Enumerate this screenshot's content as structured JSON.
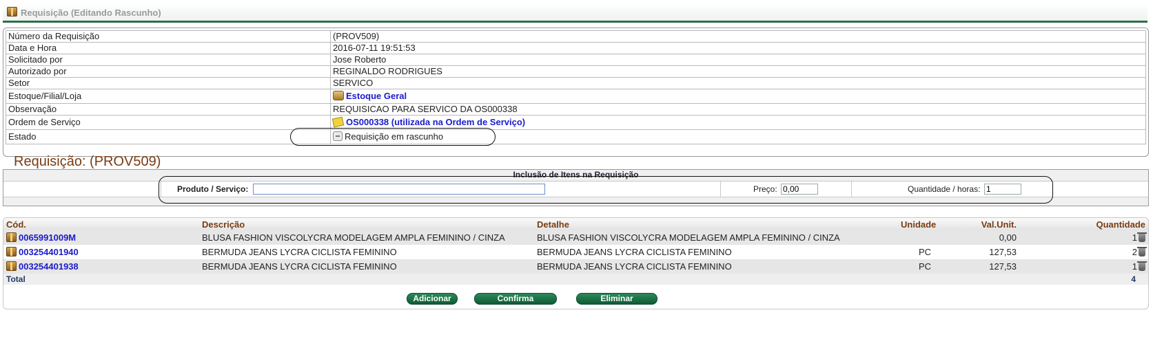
{
  "window": {
    "title": "Requisição (Editando Rascunho)"
  },
  "info": {
    "rows": [
      {
        "label": "Número da Requisição",
        "value": "(PROV509)"
      },
      {
        "label": "Data e Hora",
        "value": "2016-07-11 19:51:53"
      },
      {
        "label": "Solicitado por",
        "value": "Jose Roberto"
      },
      {
        "label": "Autorizado por",
        "value": "REGINALDO RODRIGUES"
      },
      {
        "label": "Setor",
        "value": "SERVICO"
      },
      {
        "label": "Estoque/Filial/Loja",
        "value": "Estoque Geral",
        "icon": "stock-box-icon"
      },
      {
        "label": "Observação",
        "value": "REQUISICAO PARA SERVICO DA OS000338"
      },
      {
        "label": "Ordem de Serviço",
        "value": "OS000338 (utilizada na Ordem de Serviço)",
        "icon": "note-icon"
      },
      {
        "label": "Estado",
        "value": "Requisição em rascunho",
        "icon": "draft-icon"
      }
    ]
  },
  "heading": "Requisição: (PROV509)",
  "inclusion": {
    "caption": "Inclusão de Itens na Requisição",
    "product_label": "Produto / Serviço:",
    "product_value": "",
    "price_label": "Preço:",
    "price_value": "0,00",
    "qty_label": "Quantidade / horas:",
    "qty_value": "1"
  },
  "items": {
    "columns": [
      "Cód.",
      "Descrição",
      "Detalhe",
      "Unidade",
      "Val.Unit.",
      "Quantidade"
    ],
    "rows": [
      {
        "code": "0065991009M",
        "desc": "BLUSA FASHION VISCOLYCRA MODELAGEM AMPLA FEMININO / CINZA",
        "detail": "BLUSA FASHION VISCOLYCRA MODELAGEM AMPLA  FEMININO / CINZA",
        "unit": "",
        "price": "0,00",
        "qty": "1"
      },
      {
        "code": "003254401940",
        "desc": "BERMUDA JEANS LYCRA CICLISTA FEMININO",
        "detail": "BERMUDA JEANS LYCRA CICLISTA  FEMININO",
        "unit": "PC",
        "price": "127,53",
        "qty": "2"
      },
      {
        "code": "003254401938",
        "desc": "BERMUDA JEANS LYCRA CICLISTA FEMININO",
        "detail": "BERMUDA JEANS LYCRA CICLISTA  FEMININO",
        "unit": "PC",
        "price": "127,53",
        "qty": "1"
      }
    ],
    "total_label": "Total",
    "total_qty": "4"
  },
  "buttons": {
    "add": "Adicionar",
    "confirm": "Confirma",
    "delete": "Eliminar"
  }
}
